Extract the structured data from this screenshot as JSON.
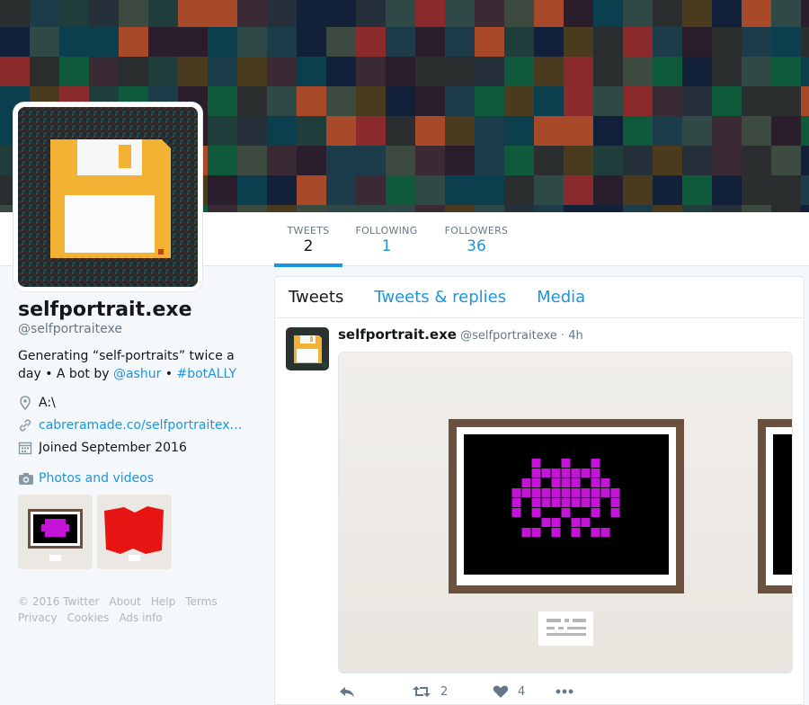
{
  "stats": [
    {
      "label": "TWEETS",
      "value": "2"
    },
    {
      "label": "FOLLOWING",
      "value": "1"
    },
    {
      "label": "FOLLOWERS",
      "value": "36"
    }
  ],
  "profile": {
    "name": "selfportrait.exe",
    "handle": "@selfportraitexe",
    "bio_text_1": "Generating “self-portraits” twice a day • A bot by ",
    "bio_mention": "@ashur",
    "bio_sep": " • ",
    "bio_hashtag": "#botALLY",
    "location": "A:\\",
    "url": "cabreramade.co/selfportraitex…",
    "joined": "Joined September 2016"
  },
  "media_section": {
    "label": "Photos and videos"
  },
  "footer": {
    "links": [
      "© 2016 Twitter",
      "About",
      "Help",
      "Terms",
      "Privacy",
      "Cookies",
      "Ads info"
    ]
  },
  "timeline": {
    "tabs": [
      "Tweets",
      "Tweets & replies",
      "Media"
    ],
    "tweet": {
      "name": "selfportrait.exe",
      "handle": "@selfportraitexe",
      "sep": " · ",
      "time": "4h",
      "retweets": "2",
      "likes": "4"
    }
  },
  "colors": {
    "accent": "#1b95e0",
    "invader": "#c414d8",
    "frame": "#6b5140",
    "floppy": "#f2b233"
  },
  "icons": [
    "location-icon",
    "link-icon",
    "calendar-icon",
    "camera-icon",
    "reply-icon",
    "retweet-icon",
    "heart-icon",
    "more-icon"
  ]
}
